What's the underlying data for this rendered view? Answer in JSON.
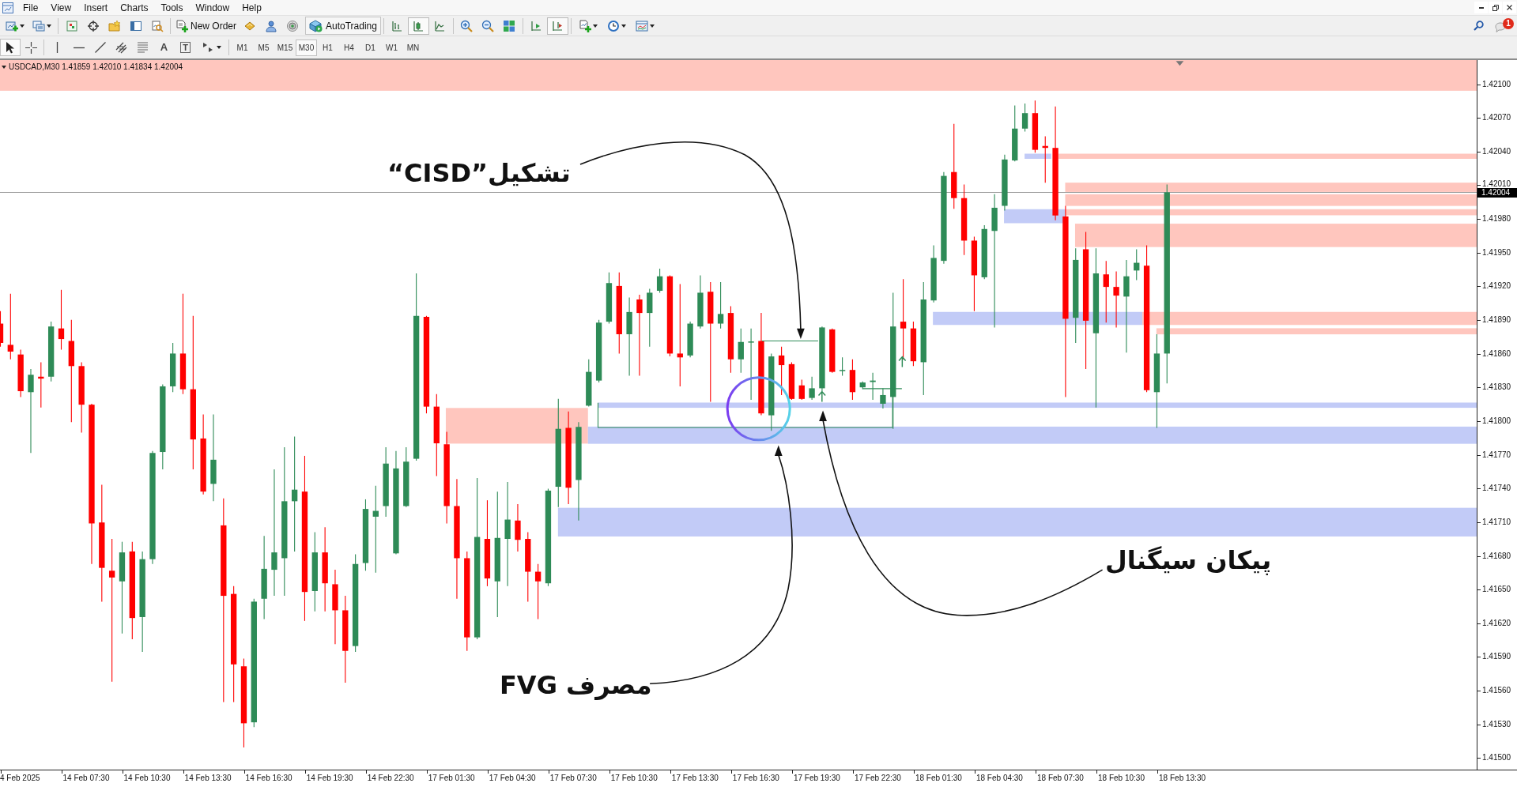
{
  "menu_bar": {
    "items": [
      "File",
      "View",
      "Insert",
      "Charts",
      "Tools",
      "Window",
      "Help"
    ]
  },
  "toolbar": {
    "new_order": "New Order",
    "autotrading": "AutoTrading",
    "chart_types": [
      {
        "kind": "bars",
        "selected": false
      },
      {
        "kind": "candles",
        "selected": true
      },
      {
        "kind": "line",
        "selected": false
      }
    ],
    "view_toggles": [
      {
        "kind": "chart_shift",
        "on": false
      },
      {
        "kind": "autoscroll",
        "on": true
      }
    ],
    "notifications": {
      "badge": "1"
    }
  },
  "drawing_toolbar": {
    "tools": [
      {
        "kind": "cursor",
        "selected": true
      },
      {
        "kind": "crosshair",
        "selected": false
      },
      {
        "kind": "vertical_line",
        "selected": false
      },
      {
        "kind": "horizontal_line",
        "selected": false
      },
      {
        "kind": "trend_line",
        "selected": false
      },
      {
        "kind": "channel",
        "selected": false
      },
      {
        "kind": "fibonacci",
        "selected": false
      },
      {
        "kind": "text",
        "glyph": "A",
        "selected": false
      },
      {
        "kind": "label",
        "glyph": "T",
        "selected": false
      },
      {
        "kind": "arrows",
        "selected": false
      }
    ],
    "periods": [
      {
        "label": "M1",
        "selected": false
      },
      {
        "label": "M5",
        "selected": false
      },
      {
        "label": "M15",
        "selected": false
      },
      {
        "label": "M30",
        "selected": true
      },
      {
        "label": "H1",
        "selected": false
      },
      {
        "label": "H4",
        "selected": false
      },
      {
        "label": "D1",
        "selected": false
      },
      {
        "label": "W1",
        "selected": false
      },
      {
        "label": "MN",
        "selected": false
      }
    ]
  },
  "chart": {
    "header": "USDCAD,M30 1.41859 1.42010 1.41834 1.42004",
    "annotations": [
      {
        "text": "“CISD”تشکیل"
      },
      {
        "text": "پیکان سیگنال"
      },
      {
        "text": "مصرف FVG"
      }
    ]
  },
  "price_axis": {
    "ticks": [
      "1.42100",
      "1.42070",
      "1.42040",
      "1.42010",
      "1.41980",
      "1.41950",
      "1.41920",
      "1.41890",
      "1.41860",
      "1.41830",
      "1.41800",
      "1.41770",
      "1.41740",
      "1.41710",
      "1.41680",
      "1.41650",
      "1.41620",
      "1.41590",
      "1.41560",
      "1.41530",
      "1.41500"
    ],
    "current_price": "1.42004"
  },
  "time_axis": {
    "labels": [
      "4 Feb 2025",
      "14 Feb 07:30",
      "14 Feb 10:30",
      "14 Feb 13:30",
      "14 Feb 16:30",
      "14 Feb 19:30",
      "14 Feb 22:30",
      "17 Feb 01:30",
      "17 Feb 04:30",
      "17 Feb 07:30",
      "17 Feb 10:30",
      "17 Feb 13:30",
      "17 Feb 16:30",
      "17 Feb 19:30",
      "17 Feb 22:30",
      "18 Feb 01:30",
      "18 Feb 04:30",
      "18 Feb 07:30",
      "18 Feb 10:30",
      "18 Feb 13:30"
    ]
  }
}
